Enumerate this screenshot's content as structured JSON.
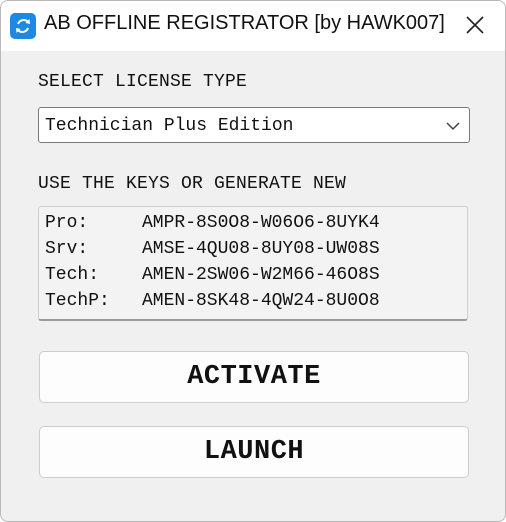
{
  "window": {
    "title": "AB OFFLINE REGISTRATOR [by HAWK007]",
    "close_icon": "close-icon",
    "app_icon": "refresh-icon"
  },
  "license": {
    "label": "SELECT LICENSE TYPE",
    "selected": "Technician Plus Edition"
  },
  "keys": {
    "label": "USE THE KEYS OR GENERATE NEW",
    "rows": [
      {
        "name": "Pro:",
        "key": "AMPR-8S0O8-W06O6-8UYK4"
      },
      {
        "name": "Srv:",
        "key": "AMSE-4QU08-8UY08-UW08S"
      },
      {
        "name": "Tech:",
        "key": "AMEN-2SW06-W2M66-46O8S"
      },
      {
        "name": "TechP:",
        "key": "AMEN-8SK48-4QW24-8U0O8"
      }
    ]
  },
  "buttons": {
    "activate": "ACTIVATE",
    "launch": "LAUNCH"
  },
  "colors": {
    "accent": "#1e88e5",
    "window_bg": "#f0f0f0",
    "titlebar_bg": "#ffffff"
  }
}
